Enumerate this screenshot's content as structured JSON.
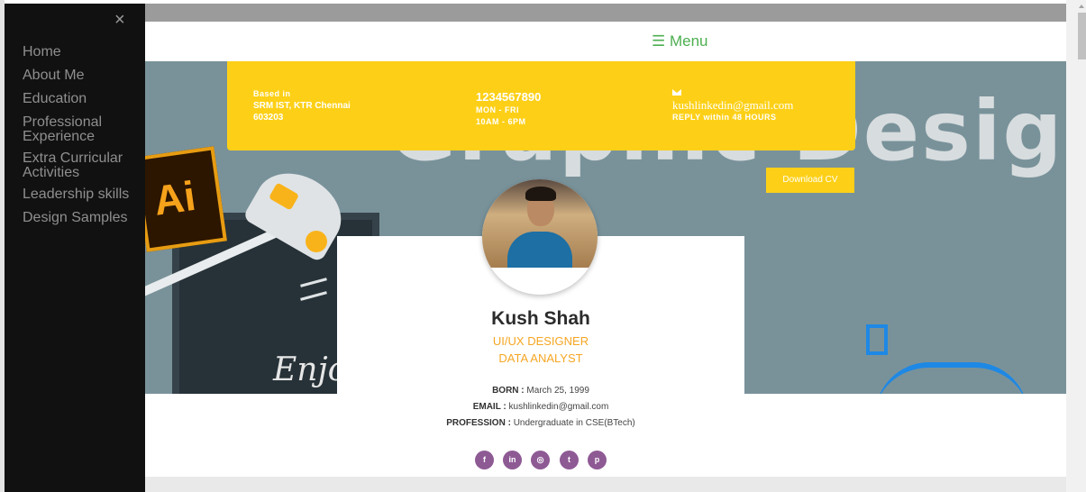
{
  "sidebar": {
    "close_symbol": "×",
    "items": [
      {
        "label": "Home"
      },
      {
        "label": "About Me"
      },
      {
        "label": "Education"
      },
      {
        "label": "Professional Experience"
      },
      {
        "label": "Extra Curricular Activities"
      },
      {
        "label": "Leadership skills"
      },
      {
        "label": "Design Samples"
      }
    ]
  },
  "header": {
    "menu_label": "☰ Menu",
    "accent_color": "#4caf50"
  },
  "hero": {
    "background_text": "Graphic Design",
    "logo_text": "Ai",
    "script_text": "Enjoy"
  },
  "info": {
    "location_label": "Based in",
    "location_line1": "SRM IST, KTR Chennai",
    "location_line2": "603203",
    "phone": "1234567890",
    "days": "MON - FRI",
    "hours": "10AM - 6PM",
    "email": "kushlinkedin@gmail.com",
    "reply": "REPLY within 48 HOURS",
    "mail_icon": "envelope-icon",
    "box_color": "#fdd017"
  },
  "download_cv": "Download CV",
  "profile": {
    "name": "Kush Shah",
    "role1": "UI/UX DESIGNER",
    "role2": "DATA ANALYST",
    "born_label": "BORN :",
    "born_value": "March 25, 1999",
    "email_label": "EMAIL :",
    "email_value": "kushlinkedin@gmail.com",
    "profession_label": "PROFESSION :",
    "profession_value": "Undergraduate in CSE(BTech)",
    "accent_color": "#f5a623"
  },
  "socials": [
    {
      "icon": "facebook-icon",
      "glyph": "f"
    },
    {
      "icon": "linkedin-icon",
      "glyph": "in"
    },
    {
      "icon": "instagram-icon",
      "glyph": "◎"
    },
    {
      "icon": "twitter-icon",
      "glyph": "t"
    },
    {
      "icon": "pinterest-icon",
      "glyph": "p"
    }
  ],
  "social_color": "#8e5a94"
}
